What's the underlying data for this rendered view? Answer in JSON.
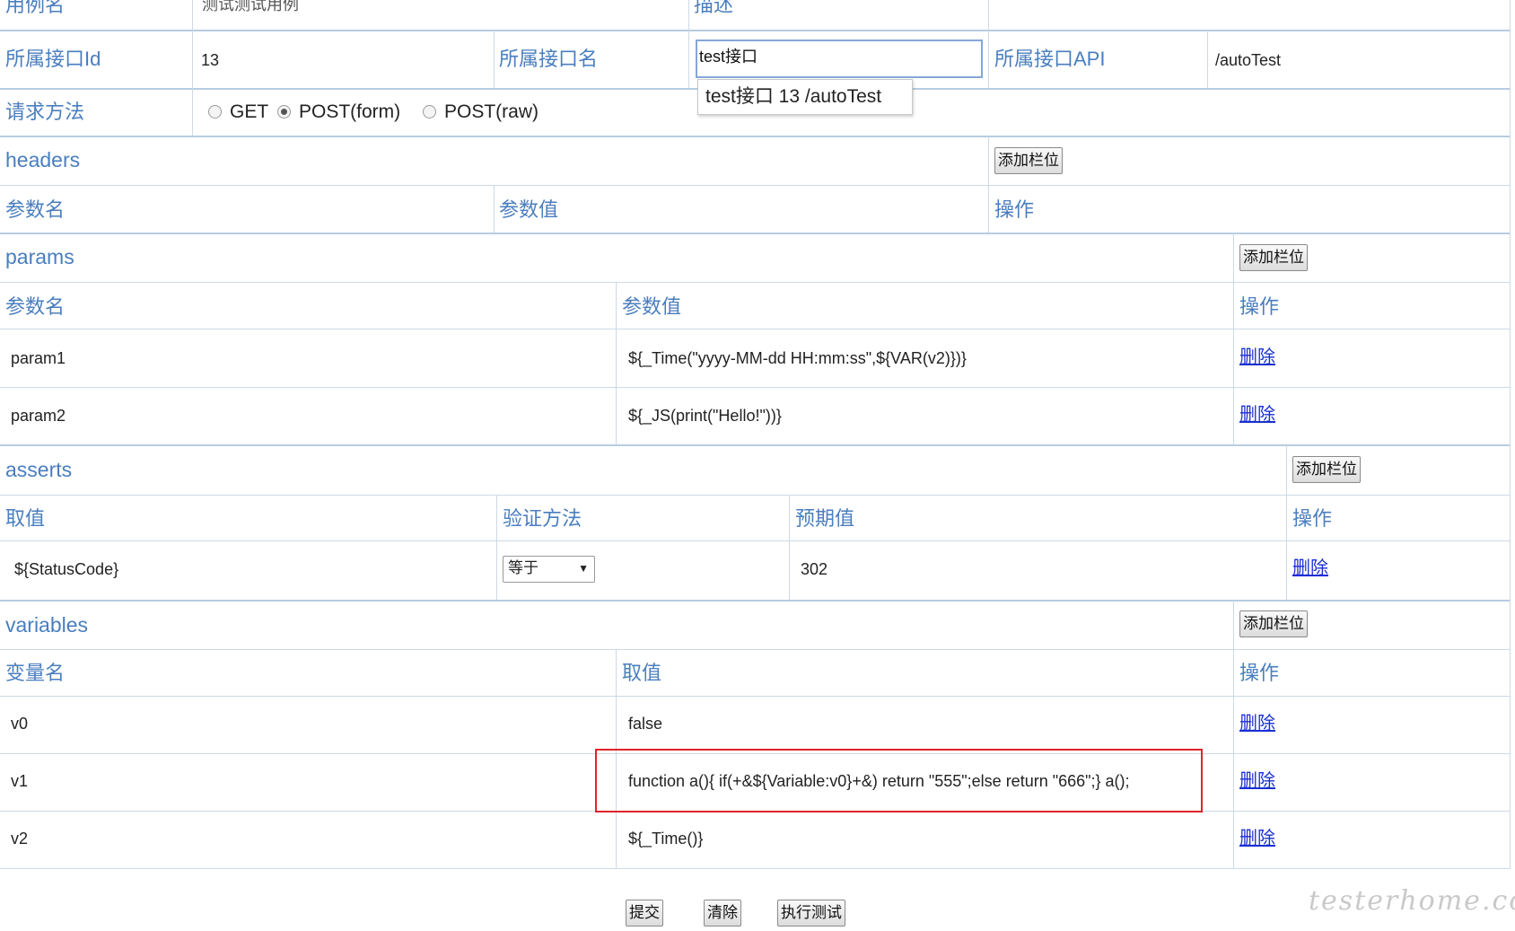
{
  "top": {
    "case_name_label": "用例名",
    "case_name_value": "测试测试用例",
    "desc_label": "描述",
    "interface_id_label": "所属接口Id",
    "interface_id_value": "13",
    "interface_name_label": "所属接口名",
    "interface_name_value": "test接口",
    "interface_api_label": "所属接口API",
    "interface_api_value": "/autoTest",
    "suggestion": "test接口 13 /autoTest",
    "method_label": "请求方法",
    "methods": [
      "GET",
      "POST(form)",
      "POST(raw)"
    ],
    "selected_method": "POST(form)"
  },
  "add_label": "添加栏位",
  "delete_label": "删除",
  "headers": {
    "title": "headers",
    "columns": [
      "参数名",
      "参数值",
      "操作"
    ]
  },
  "params": {
    "title": "params",
    "columns": [
      "参数名",
      "参数值",
      "操作"
    ],
    "rows": [
      {
        "name": "param1",
        "value": "${_Time(\"yyyy-MM-dd HH:mm:ss\",${VAR(v2)})}"
      },
      {
        "name": "param2",
        "value": "${_JS(print(\"Hello!\"))}"
      }
    ]
  },
  "asserts": {
    "title": "asserts",
    "columns": [
      "取值",
      "验证方法",
      "预期值",
      "操作"
    ],
    "rows": [
      {
        "value": "${StatusCode}",
        "method": "等于",
        "expected": "302"
      }
    ]
  },
  "variables": {
    "title": "variables",
    "columns": [
      "变量名",
      "取值",
      "操作"
    ],
    "rows": [
      {
        "name": "v0",
        "value": "false"
      },
      {
        "name": "v1",
        "value": "function a(){ if(+&${Variable:v0}+&) return \"555\";else return \"666\";} a();"
      },
      {
        "name": "v2",
        "value": "${_Time()}"
      }
    ]
  },
  "footer": {
    "submit": "提交",
    "clear": "清除",
    "run": "执行测试"
  },
  "watermark": "testerhome.com",
  "colors": {
    "label_blue": "#4a7ebf",
    "link_blue": "#1b2fd4",
    "highlight_red": "#e0232a",
    "border": "#cdd9e6"
  }
}
